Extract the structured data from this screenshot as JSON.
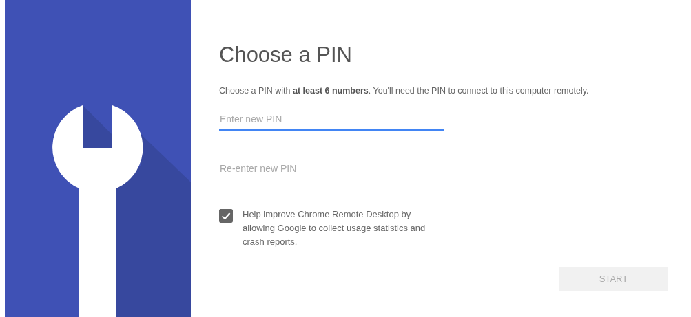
{
  "title": "Choose a PIN",
  "description": "Choose a PIN with **at least 6 numbers**. You'll need the PIN to connect to this computer remotely.",
  "fields": [
    {
      "placeholder": "Enter new PIN",
      "focused": true
    },
    {
      "placeholder": "Re-enter new PIN",
      "focused": false
    }
  ],
  "consent": {
    "checked": true,
    "label": "Help improve Chrome Remote Desktop by allowing Google to collect usage statistics and crash reports."
  },
  "start_button": {
    "label": "START",
    "disabled": true
  }
}
